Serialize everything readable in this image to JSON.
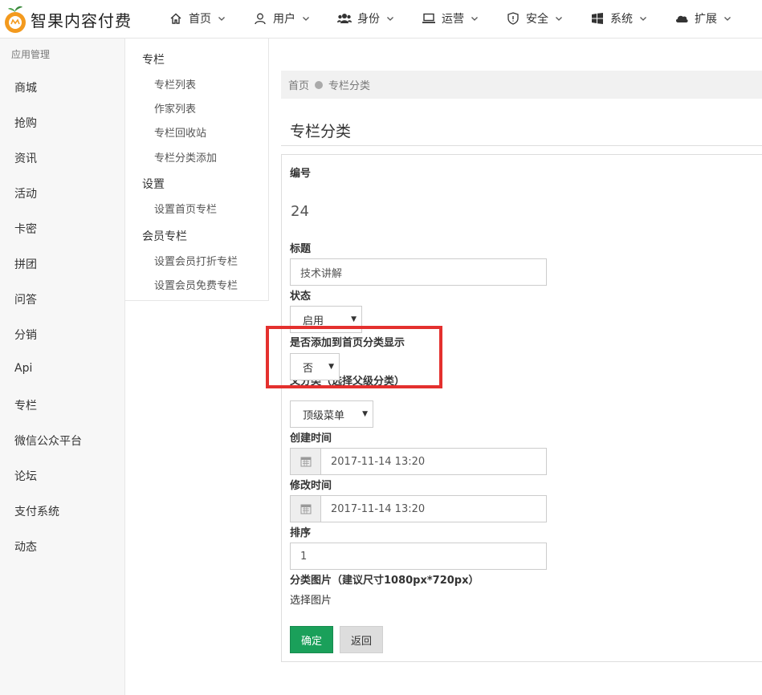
{
  "app": {
    "brand": "智果内容付费",
    "colors": {
      "brand_orange": "#f39a1e",
      "brand_green": "#3a8a3c",
      "primary": "#1aa05a",
      "highlight": "#e4302e"
    }
  },
  "nav": [
    {
      "label": "首页",
      "icon": "home-icon"
    },
    {
      "label": "用户",
      "icon": "user-icon"
    },
    {
      "label": "身份",
      "icon": "group-icon"
    },
    {
      "label": "运营",
      "icon": "laptop-icon"
    },
    {
      "label": "安全",
      "icon": "shield-icon"
    },
    {
      "label": "系统",
      "icon": "windows-icon"
    },
    {
      "label": "扩展",
      "icon": "cloud-icon"
    }
  ],
  "sidebar": {
    "header": "应用管理",
    "items": [
      "商城",
      "抢购",
      "资讯",
      "活动",
      "卡密",
      "拼团",
      "问答",
      "分销",
      "Api",
      "专栏",
      "微信公众平台",
      "论坛",
      "支付系统",
      "动态"
    ]
  },
  "submenu": {
    "groups": [
      {
        "title": "专栏",
        "items": [
          "专栏列表",
          "作家列表",
          "专栏回收站",
          "专栏分类添加"
        ]
      },
      {
        "title": "设置",
        "items": [
          "设置首页专栏"
        ]
      },
      {
        "title": "会员专栏",
        "items": [
          "设置会员打折专栏",
          "设置会员免费专栏"
        ]
      }
    ]
  },
  "breadcrumb": {
    "home": "首页",
    "current": "专栏分类"
  },
  "page_title": "专栏分类",
  "form": {
    "id_label": "编号",
    "id_value": "24",
    "title_label": "标题",
    "title_value": "技术讲解",
    "status_label": "状态",
    "status_value": "启用",
    "show_home_label": "是否添加到首页分类显示",
    "show_home_value": "否",
    "parent_label": "父分类（选择父级分类）",
    "parent_value": "顶级菜单",
    "created_label": "创建时间",
    "created_value": "2017-11-14 13:20",
    "modified_label": "修改时间",
    "modified_value": "2017-11-14 13:20",
    "sort_label": "排序",
    "sort_value": "1",
    "image_label": "分类图片（建议尺寸1080px*720px）",
    "image_link": "选择图片",
    "confirm_label": "确定",
    "back_label": "返回"
  }
}
